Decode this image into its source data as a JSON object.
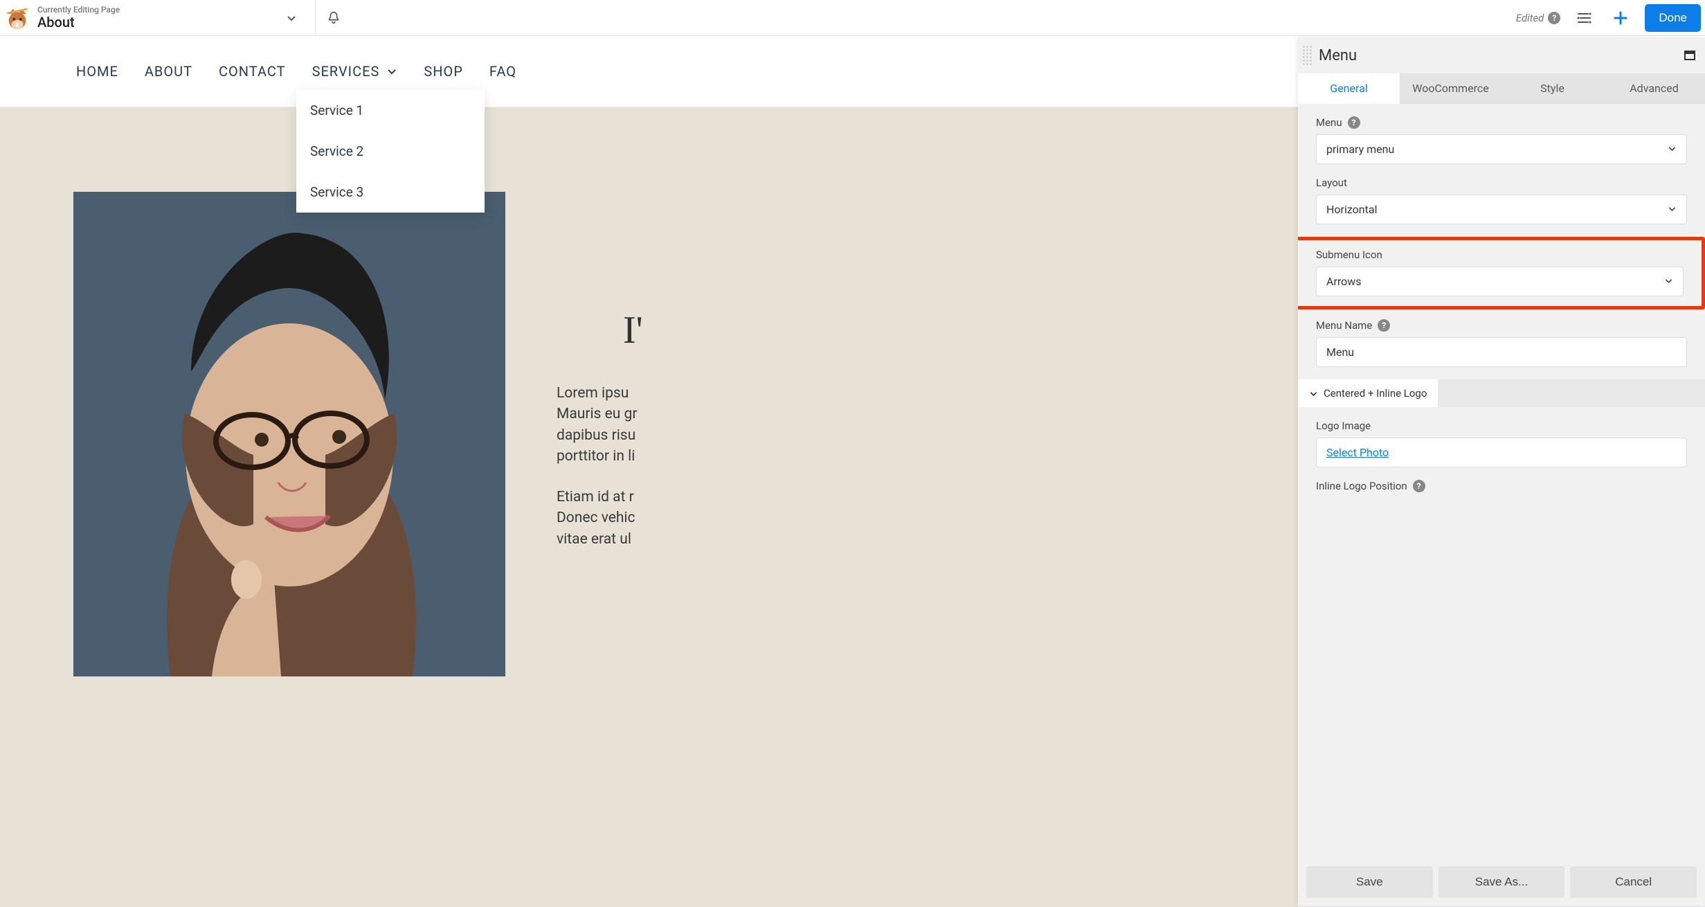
{
  "topbar": {
    "subtitle": "Currently Editing Page",
    "title": "About",
    "edited_label": "Edited",
    "done_label": "Done"
  },
  "nav": {
    "items": [
      "HOME",
      "ABOUT",
      "CONTACT",
      "SERVICES",
      "SHOP",
      "FAQ"
    ],
    "services_submenu": [
      "Service 1",
      "Service 2",
      "Service 3"
    ]
  },
  "content": {
    "heading_fragment": "I'",
    "para1_lines": [
      "Lorem ipsu",
      "Mauris eu gr",
      "dapibus risu",
      "porttitor in li"
    ],
    "para2_lines": [
      "Etiam id at r",
      "Donec vehic",
      "vitae erat ul"
    ]
  },
  "panel": {
    "title": "Menu",
    "tabs": [
      "General",
      "WooCommerce",
      "Style",
      "Advanced"
    ],
    "active_tab": 0,
    "fields": {
      "menu": {
        "label": "Menu",
        "value": "primary menu"
      },
      "layout": {
        "label": "Layout",
        "value": "Horizontal"
      },
      "submenu_icon": {
        "label": "Submenu Icon",
        "value": "Arrows"
      },
      "menu_name": {
        "label": "Menu Name",
        "value": "Menu"
      },
      "section": {
        "label": "Centered + Inline Logo"
      },
      "logo_image": {
        "label": "Logo Image",
        "action": "Select Photo"
      },
      "inline_logo_position": {
        "label": "Inline Logo Position"
      }
    },
    "actions": {
      "save": "Save",
      "save_as": "Save As...",
      "cancel": "Cancel"
    }
  }
}
